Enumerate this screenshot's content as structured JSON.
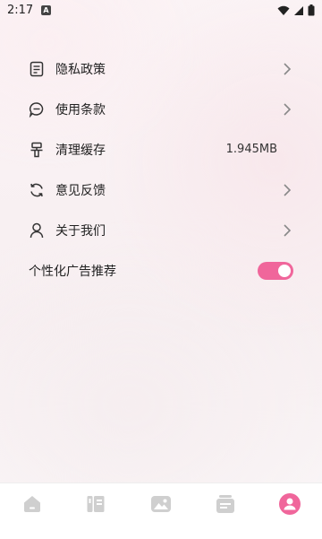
{
  "status_bar": {
    "time": "2:17",
    "notification_icon": "a-icon",
    "icons": [
      "wifi-icon",
      "signal-icon",
      "battery-icon"
    ]
  },
  "menu": {
    "items": [
      {
        "label": "隐私政策",
        "icon": "document-icon",
        "trailing": "chevron"
      },
      {
        "label": "使用条款",
        "icon": "chat-bubble-icon",
        "trailing": "chevron"
      },
      {
        "label": "清理缓存",
        "icon": "brush-icon",
        "trailing": "value",
        "value": "1.945MB"
      },
      {
        "label": "意见反馈",
        "icon": "refresh-icon",
        "trailing": "chevron"
      },
      {
        "label": "关于我们",
        "icon": "person-icon",
        "trailing": "chevron"
      }
    ],
    "ad_toggle": {
      "label": "个性化广告推荐",
      "enabled": true
    }
  },
  "bottom_nav": {
    "tabs": [
      {
        "icon": "home-icon",
        "active": false
      },
      {
        "icon": "book-icon",
        "active": false
      },
      {
        "icon": "image-icon",
        "active": false
      },
      {
        "icon": "card-icon",
        "active": false
      },
      {
        "icon": "profile-icon",
        "active": true
      }
    ]
  },
  "colors": {
    "accent": "#f0669b",
    "inactive_icon": "#cfcfcf",
    "text": "#222222"
  }
}
